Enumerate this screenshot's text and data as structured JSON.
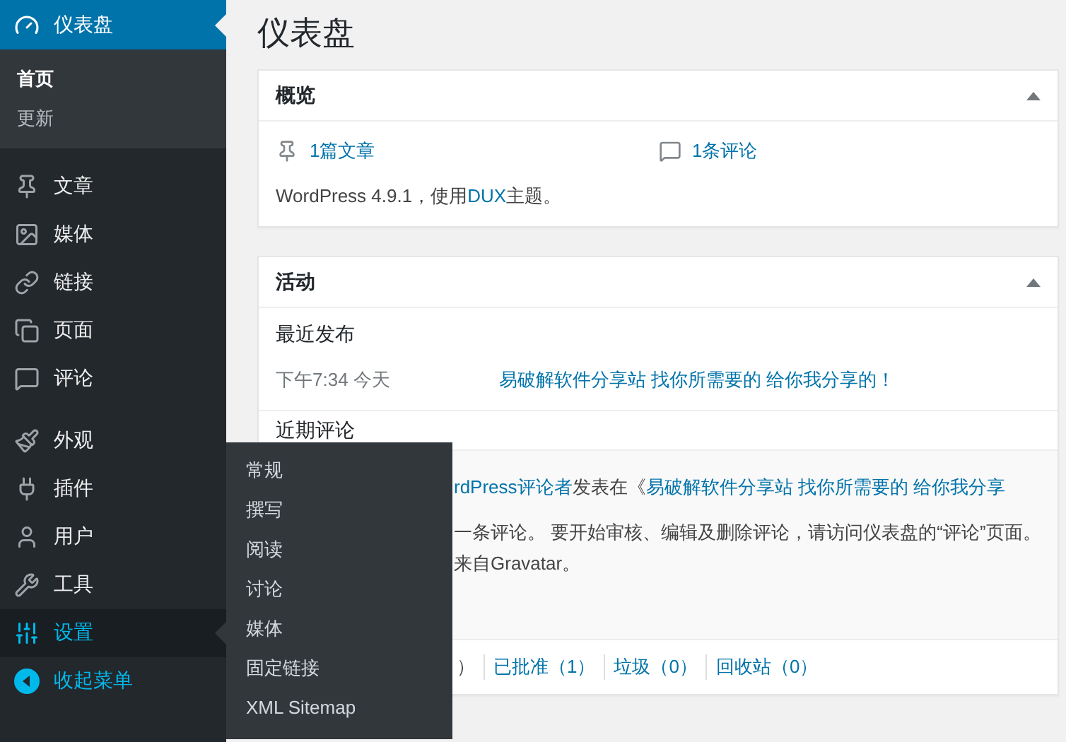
{
  "sidebar": {
    "groups": [
      [
        {
          "label": "仪表盘",
          "selected": true,
          "hovered": false,
          "children": [
            {
              "label": "首页",
              "selected": true
            },
            {
              "label": "更新",
              "selected": false
            }
          ]
        }
      ],
      [
        {
          "label": "文章",
          "selected": false,
          "hovered": false
        },
        {
          "label": "媒体",
          "selected": false,
          "hovered": false
        },
        {
          "label": "链接",
          "selected": false,
          "hovered": false
        },
        {
          "label": "页面",
          "selected": false,
          "hovered": false
        },
        {
          "label": "评论",
          "selected": false,
          "hovered": false
        }
      ],
      [
        {
          "label": "外观",
          "selected": false,
          "hovered": false
        },
        {
          "label": "插件",
          "selected": false,
          "hovered": false
        },
        {
          "label": "用户",
          "selected": false,
          "hovered": false
        },
        {
          "label": "工具",
          "selected": false,
          "hovered": false
        },
        {
          "label": "设置",
          "selected": false,
          "hovered": true
        }
      ]
    ],
    "collapse": "收起菜单"
  },
  "flyout": {
    "items": [
      "常规",
      "撰写",
      "阅读",
      "讨论",
      "媒体",
      "固定链接",
      "XML Sitemap"
    ]
  },
  "page_title": "仪表盘",
  "overview": {
    "title": "概览",
    "expanded": true,
    "stats": [
      "1篇文章",
      "1条评论"
    ],
    "version_text": "WordPress 4.9.1，使用",
    "theme_link": "DUX",
    "theme_suffix": "主题。"
  },
  "activity": {
    "title": "活动",
    "expanded": true,
    "recent_heading": "最近发布",
    "recent": [
      {
        "time": "下午7:34 今天",
        "title": "易破解软件分享站 找你所需要的 给你我分享的！"
      }
    ],
    "comments_heading": "近期评论",
    "comment": {
      "author": "rdPress评论者",
      "mid": "发表在《",
      "post": "易破解软件分享站 找你所需要的 给你我分享",
      "line2": "一条评论。 要开始审核、编辑及删除评论，请访问仪表盘的“评论”页面。",
      "line3": "来自Gravatar。"
    },
    "filters": [
      {
        "label": "）",
        "link": false
      },
      {
        "label": "已批准（1）",
        "link": true
      },
      {
        "label": "垃圾（0）",
        "link": true
      },
      {
        "label": "回收站（0）",
        "link": true
      }
    ]
  }
}
